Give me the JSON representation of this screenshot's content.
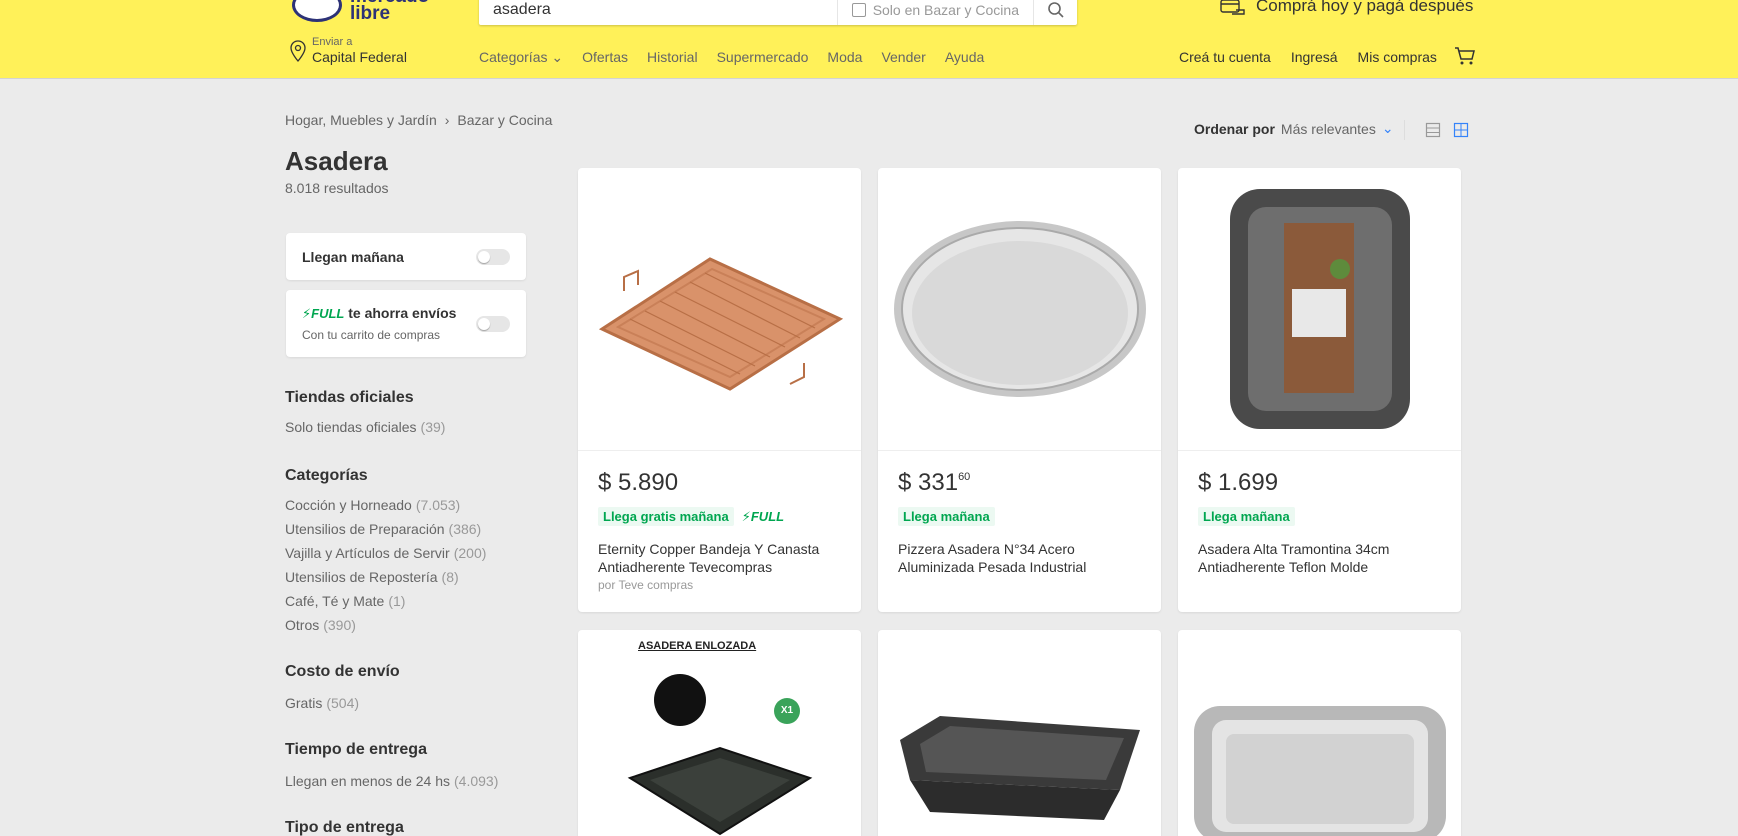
{
  "header": {
    "logo_text_1": "mercado",
    "logo_text_2": "libre",
    "search_value": "asadera",
    "search_scope": "Solo en Bazar y Cocina",
    "promo": "Comprá hoy y pagá después",
    "location_label": "Enviar a",
    "location_value": "Capital Federal",
    "nav": [
      "Categorías",
      "Ofertas",
      "Historial",
      "Supermercado",
      "Moda",
      "Vender",
      "Ayuda"
    ],
    "account": [
      "Creá tu cuenta",
      "Ingresá",
      "Mis compras"
    ],
    "bg_color": "#fff159"
  },
  "breadcrumb": [
    "Hogar, Muebles y Jardín",
    "Bazar y Cocina"
  ],
  "title": "Asadera",
  "results": "8.018 resultados",
  "filters": {
    "tomorrow": "Llegan mañana",
    "full_label": "FULL",
    "full_text": "te ahorra envíos",
    "full_sub": "Con tu carrito de compras"
  },
  "sections": [
    {
      "title": "Tiendas oficiales",
      "items": [
        {
          "label": "Solo tiendas oficiales",
          "count": "(39)"
        }
      ]
    },
    {
      "title": "Categorías",
      "items": [
        {
          "label": "Cocción y Horneado",
          "count": "(7.053)"
        },
        {
          "label": "Utensilios de Preparación",
          "count": "(386)"
        },
        {
          "label": "Vajilla y Artículos de Servir",
          "count": "(200)"
        },
        {
          "label": "Utensilios de Repostería",
          "count": "(8)"
        },
        {
          "label": "Café, Té y Mate",
          "count": "(1)"
        },
        {
          "label": "Otros",
          "count": "(390)"
        }
      ]
    },
    {
      "title": "Costo de envío",
      "items": [
        {
          "label": "Gratis",
          "count": "(504)"
        }
      ]
    },
    {
      "title": "Tiempo de entrega",
      "items": [
        {
          "label": "Llegan en menos de 24 hs",
          "count": "(4.093)"
        }
      ]
    },
    {
      "title": "Tipo de entrega",
      "items": []
    }
  ],
  "sort": {
    "label": "Ordenar por",
    "value": "Más relevantes"
  },
  "products": [
    {
      "price": "$ 5.890",
      "cents": "",
      "shipping": "Llega gratis mañana",
      "full": "FULL",
      "title": "Eternity Copper Bandeja Y Canasta Antiadherente Tevecompras",
      "seller": "por Teve compras"
    },
    {
      "price": "$ 331",
      "cents": "60",
      "shipping": "Llega mañana",
      "full": "",
      "title": "Pizzera Asadera N°34 Acero Aluminizada Pesada Industrial",
      "seller": ""
    },
    {
      "price": "$ 1.699",
      "cents": "",
      "shipping": "Llega mañana",
      "full": "",
      "title": "Asadera Alta Tramontina 34cm Antiadherente Teflon Molde",
      "seller": ""
    }
  ],
  "product_row2": {
    "badge": "ASADERA ENLOZADA",
    "badge_count": "X1"
  }
}
